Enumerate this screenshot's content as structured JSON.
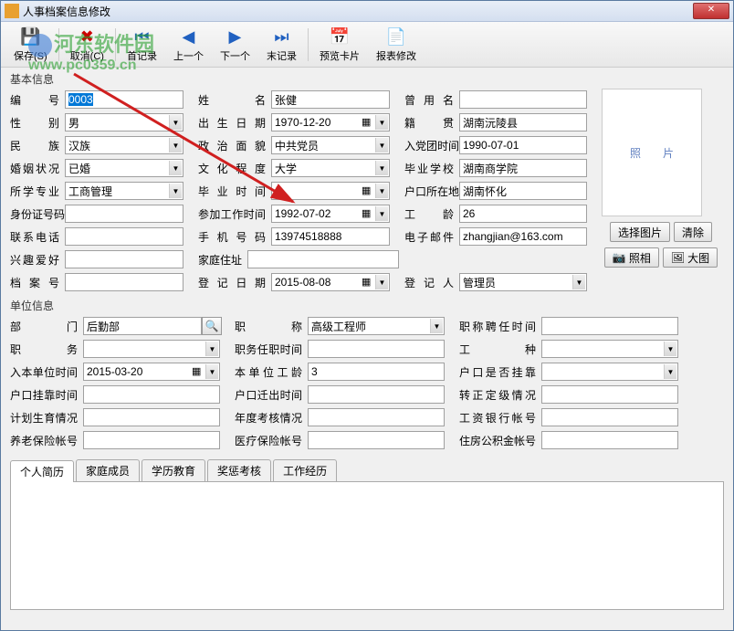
{
  "window": {
    "title": "人事档案信息修改"
  },
  "toolbar": {
    "save": "保存(S)",
    "cancel": "取消(C)",
    "first": "首记录",
    "prev": "上一个",
    "next": "下一个",
    "last": "末记录",
    "preview": "预览卡片",
    "report": "报表修改"
  },
  "sections": {
    "basic": "基本信息",
    "unit": "单位信息"
  },
  "labels": {
    "id": "编　号",
    "name": "姓　名",
    "former_name": "曾 用 名",
    "gender": "性　别",
    "birth": "出生日期",
    "native": "籍　贯",
    "nation": "民　族",
    "political": "政治面貌",
    "party_date": "入党团时间",
    "marriage": "婚姻状况",
    "education": "文化程度",
    "school": "毕业学校",
    "major": "所学专业",
    "grad_date": "毕业时间",
    "hukou_loc": "户口所在地",
    "id_card": "身份证号码",
    "work_date": "参加工作时间",
    "work_age": "工　龄",
    "phone": "联系电话",
    "mobile": "手机号码",
    "email": "电子邮件",
    "hobby": "兴趣爱好",
    "address": "家庭住址",
    "file_no": "档 案 号",
    "reg_date": "登记日期",
    "registrar": "登 记 人",
    "dept": "部　门",
    "title": "职　称",
    "title_date": "职称聘任时间",
    "position": "职　务",
    "pos_date": "职务任职时间",
    "work_type": "工　种",
    "join_date": "入本单位时间",
    "unit_age": "本单位工龄",
    "hukou_attach": "户口是否挂靠",
    "hukou_time": "户口挂靠时间",
    "hukou_out": "户口迁出时间",
    "regular": "转正定级情况",
    "birth_plan": "计划生育情况",
    "annual": "年度考核情况",
    "salary_bank": "工资银行帐号",
    "pension": "养老保险帐号",
    "medical": "医疗保险帐号",
    "housing": "住房公积金帐号"
  },
  "values": {
    "id": "0003",
    "name": "张健",
    "former_name": "",
    "gender": "男",
    "birth": "1970-12-20",
    "native": "湖南沅陵县",
    "nation": "汉族",
    "political": "中共党员",
    "party_date": "1990-07-01",
    "marriage": "已婚",
    "education": "大学",
    "school": "湖南商学院",
    "major": "工商管理",
    "grad_date": "",
    "hukou_loc": "湖南怀化",
    "id_card": "",
    "work_date": "1992-07-02",
    "work_age": "26",
    "phone": "",
    "mobile": "13974518888",
    "email": "zhangjian@163.com",
    "hobby": "",
    "address": "",
    "file_no": "",
    "reg_date": "2015-08-08",
    "registrar": "管理员",
    "dept": "后勤部",
    "title": "高级工程师",
    "title_date": "",
    "position": "",
    "pos_date": "",
    "work_type": "",
    "join_date": "2015-03-20",
    "unit_age": "3",
    "hukou_attach": "",
    "hukou_time": "",
    "hukou_out": "",
    "regular": "",
    "birth_plan": "",
    "annual": "",
    "salary_bank": "",
    "pension": "",
    "medical": "",
    "housing": ""
  },
  "photo": {
    "placeholder": "照片",
    "select": "选择图片",
    "clear": "清除",
    "camera": "照相",
    "enlarge": "大图"
  },
  "tabs": [
    "个人简历",
    "家庭成员",
    "学历教育",
    "奖惩考核",
    "工作经历"
  ],
  "watermark": {
    "brand": "河东软件园",
    "url": "www.pc0359.cn"
  }
}
